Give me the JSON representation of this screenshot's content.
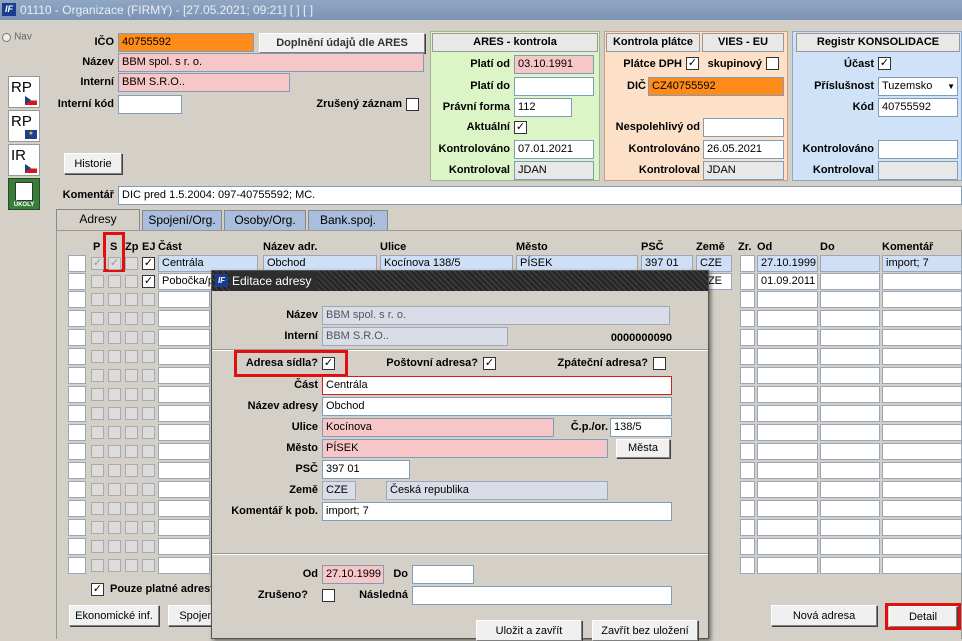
{
  "window": {
    "title": "01110 - Organizace (FIRMY) - [27.05.2021; 09:21]  [ ]  [ ]",
    "nav_label": "Nav"
  },
  "side_icons": [
    "RP",
    "RP",
    "IR",
    "ÚKOLY"
  ],
  "header": {
    "ico_label": "IČO",
    "ico_value": "40755592",
    "doplneni_button": "Doplnění údajů dle ARES",
    "nazev_label": "Název",
    "nazev_value": "BBM spol. s r. o.",
    "interni_label": "Interní",
    "interni_value": "BBM S.R.O..",
    "interni_kod_label": "Interní kód",
    "interni_kod_value": "",
    "zruseny_label": "Zrušený záznam",
    "historie_button": "Historie",
    "komentar_label": "Komentář",
    "komentar_value": "DIC pred 1.5.2004: 097-40755592; MC."
  },
  "ares": {
    "title": "ARES - kontrola",
    "plati_od_label": "Platí od",
    "plati_od_value": "03.10.1991",
    "plati_do_label": "Platí do",
    "plati_do_value": "",
    "pravni_forma_label": "Právní forma",
    "pravni_forma_value": "112",
    "aktualni_label": "Aktuální",
    "kontrolovano_label": "Kontrolováno",
    "kontrolovano_value": "07.01.2021",
    "kontroloval_label": "Kontroloval",
    "kontroloval_value": "JDAN"
  },
  "platce": {
    "title": "Kontrola plátce",
    "vies_title": "VIES - EU",
    "platce_dph_label": "Plátce DPH",
    "skupinovy_label": "skupinový",
    "dic_label": "DIČ",
    "dic_value": "CZ40755592",
    "nespolehlivy_label": "Nespolehlivý od",
    "nespolehlivy_value": "",
    "kontrolovano_label": "Kontrolováno",
    "kontrolovano_value": "26.05.2021",
    "kontroloval_label": "Kontroloval",
    "kontroloval_value": "JDAN"
  },
  "konsolidace": {
    "title": "Registr KONSOLIDACE",
    "ucast_label": "Účast",
    "prislusnost_label": "Příslušnost",
    "prislusnost_value": "Tuzemsko",
    "kod_label": "Kód",
    "kod_value": "40755592",
    "kontrolovano_label": "Kontrolováno",
    "kontrolovano_value": "",
    "kontroloval_label": "Kontroloval",
    "kontroloval_value": ""
  },
  "tabs": [
    "Adresy",
    "Spojení/Org.",
    "Osoby/Org.",
    "Bank.spoj."
  ],
  "grid": {
    "headers": {
      "p": "P",
      "s": "S",
      "zp": "Zp",
      "ej": "EJ",
      "cast": "Část",
      "nazev_adr": "Název adr.",
      "ulice": "Ulice",
      "mesto": "Město",
      "psc": "PSČ",
      "zeme": "Země",
      "zr": "Zr.",
      "od": "Od",
      "do": "Do",
      "komentar": "Komentář"
    },
    "rows": [
      {
        "cast": "Centrála",
        "nazev": "Obchod",
        "ulice": "Kocínova 138/5",
        "mesto": "PÍSEK",
        "psc": "397 01",
        "zeme": "CZE",
        "od": "27.10.1999",
        "do": "",
        "komentar": "import; 7"
      },
      {
        "cast": "Pobočka/p",
        "nazev": "",
        "ulice": "",
        "mesto": "",
        "psc": "",
        "zeme": "CZE",
        "od": "01.09.2011",
        "do": "",
        "komentar": ""
      }
    ],
    "pouze_platne_label": "Pouze platné adresy"
  },
  "bottom": {
    "ekonomicke_button": "Ekonomické inf.",
    "spojeni_button": "Spojení",
    "nova_adresa_button": "Nová adresa",
    "detail_button": "Detail"
  },
  "dialog": {
    "title": "Editace adresy",
    "nazev_label": "Název",
    "nazev_value": "BBM spol. s r. o.",
    "interni_label": "Interní",
    "interni_value": "BBM S.R.O..",
    "id_value": "0000000090",
    "adresa_sidla_label": "Adresa sídla?",
    "postovni_label": "Poštovní adresa?",
    "zpatecni_label": "Zpáteční adresa?",
    "cast_label": "Část",
    "cast_value": "Centrála",
    "nazev_adresy_label": "Název adresy",
    "nazev_adresy_value": "Obchod",
    "ulice_label": "Ulice",
    "ulice_value": "Kocínova",
    "cp_label": "Č.p./or.",
    "cp_value": "138/5",
    "mesto_label": "Město",
    "mesto_value": "PÍSEK",
    "mesta_button": "Města",
    "psc_label": "PSČ",
    "psc_value": "397 01",
    "zeme_label": "Země",
    "zeme_code": "CZE",
    "zeme_name": "Česká republika",
    "komentar_label": "Komentář k pob.",
    "komentar_value": "import; 7",
    "od_label": "Od",
    "od_value": "27.10.1999",
    "do_label": "Do",
    "do_value": "",
    "zruseno_label": "Zrušeno?",
    "nasledna_label": "Následná",
    "nasledna_value": "",
    "ulozit_button": "Uložit a zavřít",
    "zavrit_button": "Zavřít bez uložení"
  }
}
